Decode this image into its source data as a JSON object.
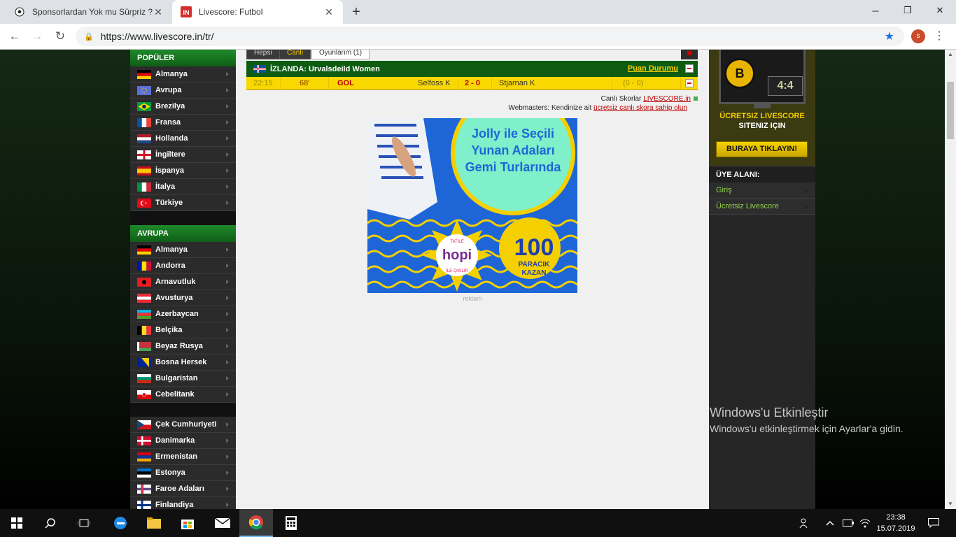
{
  "browser": {
    "tabs": [
      {
        "title": "Sponsorlardan Yok mu Sürpriz ? -",
        "active": false
      },
      {
        "title": "Livescore: Futbol",
        "active": true
      }
    ],
    "favicon_text": "IN",
    "url": "https://www.livescore.in/tr/",
    "profile_initial": "s"
  },
  "sidebar": {
    "sections": [
      {
        "heading": "POPÜLER",
        "items": [
          "Almanya",
          "Avrupa",
          "Brezilya",
          "Fransa",
          "Hollanda",
          "İngiltere",
          "İspanya",
          "İtalya",
          "Türkiye"
        ]
      },
      {
        "heading": "AVRUPA",
        "items": [
          "Almanya",
          "Andorra",
          "Arnavutluk",
          "Avusturya",
          "Azerbaycan",
          "Belçika",
          "Beyaz Rusya",
          "Bosna Hersek",
          "Bulgaristan",
          "Cebelitank"
        ]
      },
      {
        "heading": "",
        "items": [
          "Çek Cumhuriyeti",
          "Danimarka",
          "Ermenistan",
          "Estonya",
          "Faroe Adaları",
          "Finlandiya"
        ]
      }
    ]
  },
  "main": {
    "tabs": {
      "all": "Hepsi",
      "live": "Canlı",
      "my_games": "Oyunlarım (1)"
    },
    "league": {
      "name": "İZLANDA: Urvalsdeild Women",
      "standings": "Puan Durumu"
    },
    "match": {
      "time": "22:15",
      "minute": "68'",
      "event": "GOL",
      "home": "Selfoss K",
      "score": "2 - 0",
      "away": "Stjarnan K",
      "halftime": "(0 - 0)"
    },
    "credits": {
      "line1_prefix": "Canlı Skorlar",
      "line1_link": "LIVESCORE.in",
      "line2_prefix": "Webmasters: Kendinize ait",
      "line2_link": "ücretsiz canlı skora sahip olun"
    },
    "ad": {
      "headline_lines": [
        "Jolly ile Seçili",
        "Yunan Adaları",
        "Gemi Turlarında"
      ],
      "brand": "hopi",
      "badge_top": "TATİLE",
      "badge_bottom": "İLE ÇIKILIR",
      "points": "100",
      "points_label1": "PARACIK",
      "points_label2": "KAZAN",
      "label": "reklam"
    }
  },
  "right": {
    "promo_score": "4:4",
    "promo_title": "ÜCRETSIZ LIVESCORE",
    "promo_subtitle": "SITENIZ IÇIN",
    "promo_button": "BURAYA TIKLAYIN!",
    "member_heading": "ÜYE ALANI:",
    "member_items": [
      "Giriş",
      "Ücretsiz Livescore"
    ]
  },
  "watermark": {
    "line1": "Windows'u Etkinleştir",
    "line2": "Windows'u etkinleştirmek için Ayarlar'a gidin."
  },
  "taskbar": {
    "time": "23:38",
    "date": "15.07.2019"
  },
  "colors": {
    "accent_green": "#0e5c12",
    "match_yellow": "#f8d800",
    "link_red": "#bb0000",
    "ad_blue": "#1e66d8"
  }
}
